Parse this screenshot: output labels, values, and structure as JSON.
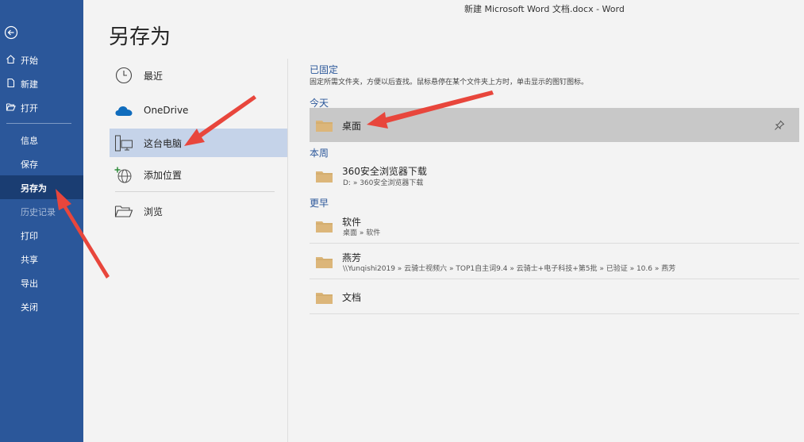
{
  "window": {
    "title": "新建 Microsoft Word 文档.docx  -  Word"
  },
  "nav": {
    "top_items": [
      {
        "label": "开始",
        "icon": "home-icon"
      },
      {
        "label": "新建",
        "icon": "new-document-icon"
      },
      {
        "label": "打开",
        "icon": "open-folder-icon"
      }
    ],
    "items": [
      {
        "label": "信息"
      },
      {
        "label": "保存"
      },
      {
        "label": "另存为",
        "active": true
      },
      {
        "label": "历史记录",
        "disabled": true
      },
      {
        "label": "打印"
      },
      {
        "label": "共享"
      },
      {
        "label": "导出"
      },
      {
        "label": "关闭"
      }
    ]
  },
  "page": {
    "heading": "另存为"
  },
  "locations": [
    {
      "label": "最近",
      "icon": "clock-icon"
    },
    {
      "label": "OneDrive",
      "icon": "cloud-icon"
    },
    {
      "label": "这台电脑",
      "icon": "computer-icon",
      "selected": true
    },
    {
      "label": "添加位置",
      "icon": "globe-add-icon"
    },
    {
      "label": "浏览",
      "icon": "browse-folder-icon"
    }
  ],
  "recent": {
    "pinned_title": "已固定",
    "pinned_desc": "固定所需文件夹，方便以后查找。鼠标悬停在某个文件夹上方时，单击显示的图钉图标。",
    "today_title": "今天",
    "week_title": "本周",
    "earlier_title": "更早",
    "today": [
      {
        "name": "桌面",
        "path": ""
      }
    ],
    "week": [
      {
        "name": "360安全浏览器下载",
        "path": "D: » 360安全浏览器下载"
      }
    ],
    "earlier": [
      {
        "name": "软件",
        "path": "桌面 » 软件"
      },
      {
        "name": "燕芳",
        "path": "\\\\Yunqishi2019 » 云骑士视频六 » TOP1自主词9.4 » 云骑士+电子科技+第5批 » 已验证 » 10.6 » 燕芳"
      },
      {
        "name": "文档",
        "path": ""
      }
    ]
  },
  "colors": {
    "nav_bg": "#2b579a",
    "nav_active": "#1a3d72",
    "accent": "#2b579a",
    "folder": "#dcb67a",
    "annotation_arrow": "#e8463c"
  }
}
